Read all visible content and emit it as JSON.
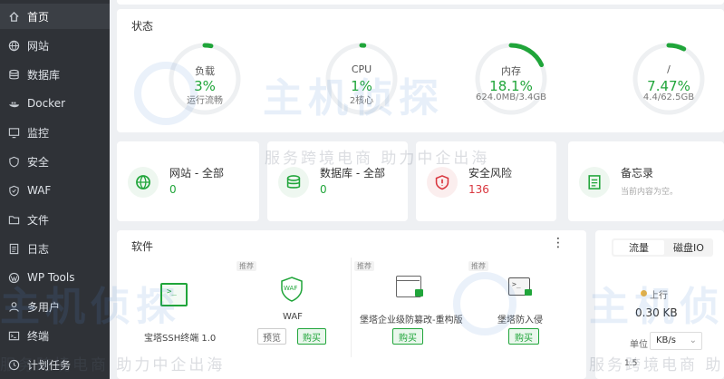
{
  "sidebar": {
    "items": [
      {
        "label": "首页",
        "icon": "home-icon",
        "active": true
      },
      {
        "label": "网站",
        "icon": "globe-icon"
      },
      {
        "label": "数据库",
        "icon": "database-icon"
      },
      {
        "label": "Docker",
        "icon": "docker-icon"
      },
      {
        "label": "监控",
        "icon": "monitor-icon"
      },
      {
        "label": "安全",
        "icon": "shield-icon"
      },
      {
        "label": "WAF",
        "icon": "waf-shield-icon"
      },
      {
        "label": "文件",
        "icon": "folder-icon"
      },
      {
        "label": "日志",
        "icon": "log-icon"
      },
      {
        "label": "WP Tools",
        "icon": "wordpress-icon"
      },
      {
        "label": "多用户",
        "icon": "users-icon"
      },
      {
        "label": "终端",
        "icon": "terminal-icon"
      },
      {
        "label": "计划任务",
        "icon": "clock-icon"
      }
    ]
  },
  "status": {
    "title": "状态",
    "gauges": [
      {
        "label": "负载",
        "value": "3%",
        "sub": "运行流畅",
        "fraction": 0.03
      },
      {
        "label": "CPU",
        "value": "1%",
        "sub": "2核心",
        "fraction": 0.01
      },
      {
        "label": "内存",
        "value": "18.1%",
        "sub": "624.0MB/3.4GB",
        "fraction": 0.181
      },
      {
        "label": "/",
        "value": "7.47%",
        "sub": "4.4/62.5GB",
        "fraction": 0.0747
      }
    ]
  },
  "overview": {
    "website": {
      "title": "网站 - 全部",
      "value": "0"
    },
    "database": {
      "title": "数据库 - 全部",
      "value": "0"
    },
    "risk": {
      "title": "安全风险",
      "value": "136"
    },
    "memo": {
      "title": "备忘录",
      "sub": "当前内容为空。"
    }
  },
  "software": {
    "title": "软件",
    "more": "⋮",
    "items": {
      "ssh": {
        "name": "宝塔SSH终端 1.0",
        "tag": "推荐"
      },
      "waf": {
        "name": "WAF",
        "btn_preview": "预览",
        "btn_buy": "购买",
        "badge": "WAF"
      },
      "tamper": {
        "name": "堡塔企业级防篡改-重构版",
        "tag": "推荐",
        "btn_buy": "购买"
      },
      "intrusion": {
        "name": "堡塔防入侵",
        "tag": "推荐",
        "btn_buy": "购买"
      }
    }
  },
  "traffic": {
    "tabs": [
      "流量",
      "磁盘IO"
    ],
    "upload_label": "上行",
    "upload_value": "0.30 KB",
    "unit_label": "单位",
    "unit_value": "KB/s",
    "axis_value": "1.5"
  },
  "watermark": {
    "brand": "主机侦探",
    "slogan": "服务跨境电商 助力中企出海"
  },
  "colors": {
    "accent": "#20a53a",
    "danger": "#d9363e",
    "sidebar": "#2f3237"
  }
}
